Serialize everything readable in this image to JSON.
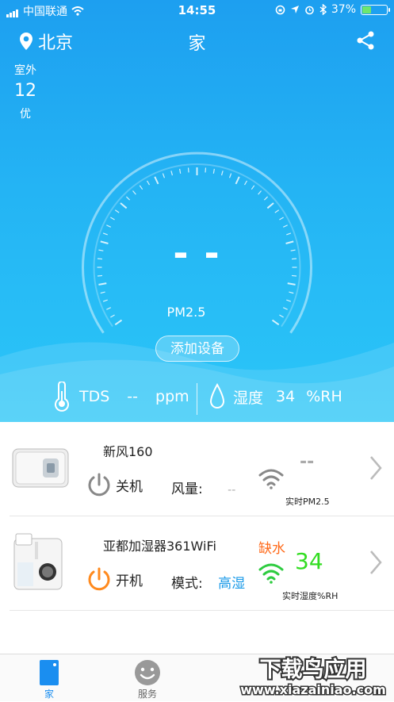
{
  "status_bar": {
    "carrier": "中国联通",
    "time": "14:55",
    "battery": "37%",
    "battery_level": 0.37
  },
  "header": {
    "location": "北京",
    "title": "家",
    "location_icon": "map-pin-icon",
    "share_icon": "share-icon"
  },
  "outdoor": {
    "label": "室外",
    "value": "12",
    "quality": "优"
  },
  "gauge": {
    "value": "- -",
    "label": "PM2.5"
  },
  "add_device": "添加设备",
  "readings": {
    "tds_label": "TDS",
    "tds_value": "--",
    "tds_unit": "ppm",
    "humidity_label": "湿度",
    "humidity_value": "34",
    "humidity_unit": "%RH"
  },
  "devices": [
    {
      "name": "新风160",
      "power_state": "关机",
      "mode_label": "风量:",
      "mode_value": "--",
      "reading": "--",
      "reading_label": "实时PM2.5",
      "status": "",
      "accent": "#888888"
    },
    {
      "name": "亚都加湿器361WiFi",
      "power_state": "开机",
      "mode_label": "模式:",
      "mode_value": "高湿",
      "reading": "34",
      "reading_label": "实时湿度%RH",
      "status": "缺水",
      "accent": "#ff8a1e"
    }
  ],
  "tabs": [
    {
      "label": "家",
      "icon": "device-icon",
      "active": true
    },
    {
      "label": "服务",
      "icon": "smiley-icon",
      "active": false
    }
  ],
  "watermark": {
    "title": "下载鸟应用",
    "url": "www.xiazainiao.com"
  },
  "colors": {
    "hero_top": "#1d9ff0",
    "hero_bottom": "#2bc6f8",
    "active_tab": "#1a8ef0",
    "wifi_on": "#2ecc40",
    "reading_on": "#33dd22",
    "alert": "#ff6a1a",
    "mode_value": "#1a9ae8"
  }
}
